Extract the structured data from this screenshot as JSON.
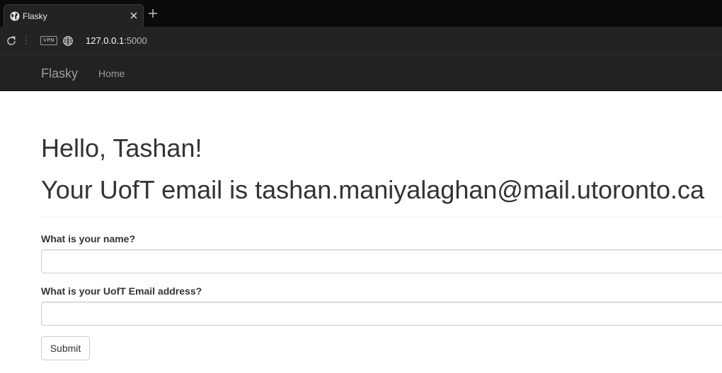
{
  "browser": {
    "tab_title": "Flasky",
    "url_host": "127.0.0.1",
    "url_port": ":5000",
    "vpn_label": "VPN",
    "icons": [
      "globe-favicon-icon",
      "close-icon",
      "plus-icon",
      "reload-icon",
      "globe-icon"
    ]
  },
  "navbar": {
    "brand": "Flasky",
    "items": [
      {
        "label": "Home"
      }
    ]
  },
  "main": {
    "greeting": "Hello, Tashan!",
    "email_line": "Your UofT email is tashan.maniyalaghan@mail.utoronto.ca"
  },
  "form": {
    "name_label": "What is your name?",
    "name_value": "",
    "email_label": "What is your UofT Email address?",
    "email_value": "",
    "submit_label": "Submit"
  },
  "colors": {
    "navbar_bg": "#222222",
    "nav_text": "#9d9d9d",
    "body_text": "#333333",
    "input_border": "#cccccc"
  }
}
